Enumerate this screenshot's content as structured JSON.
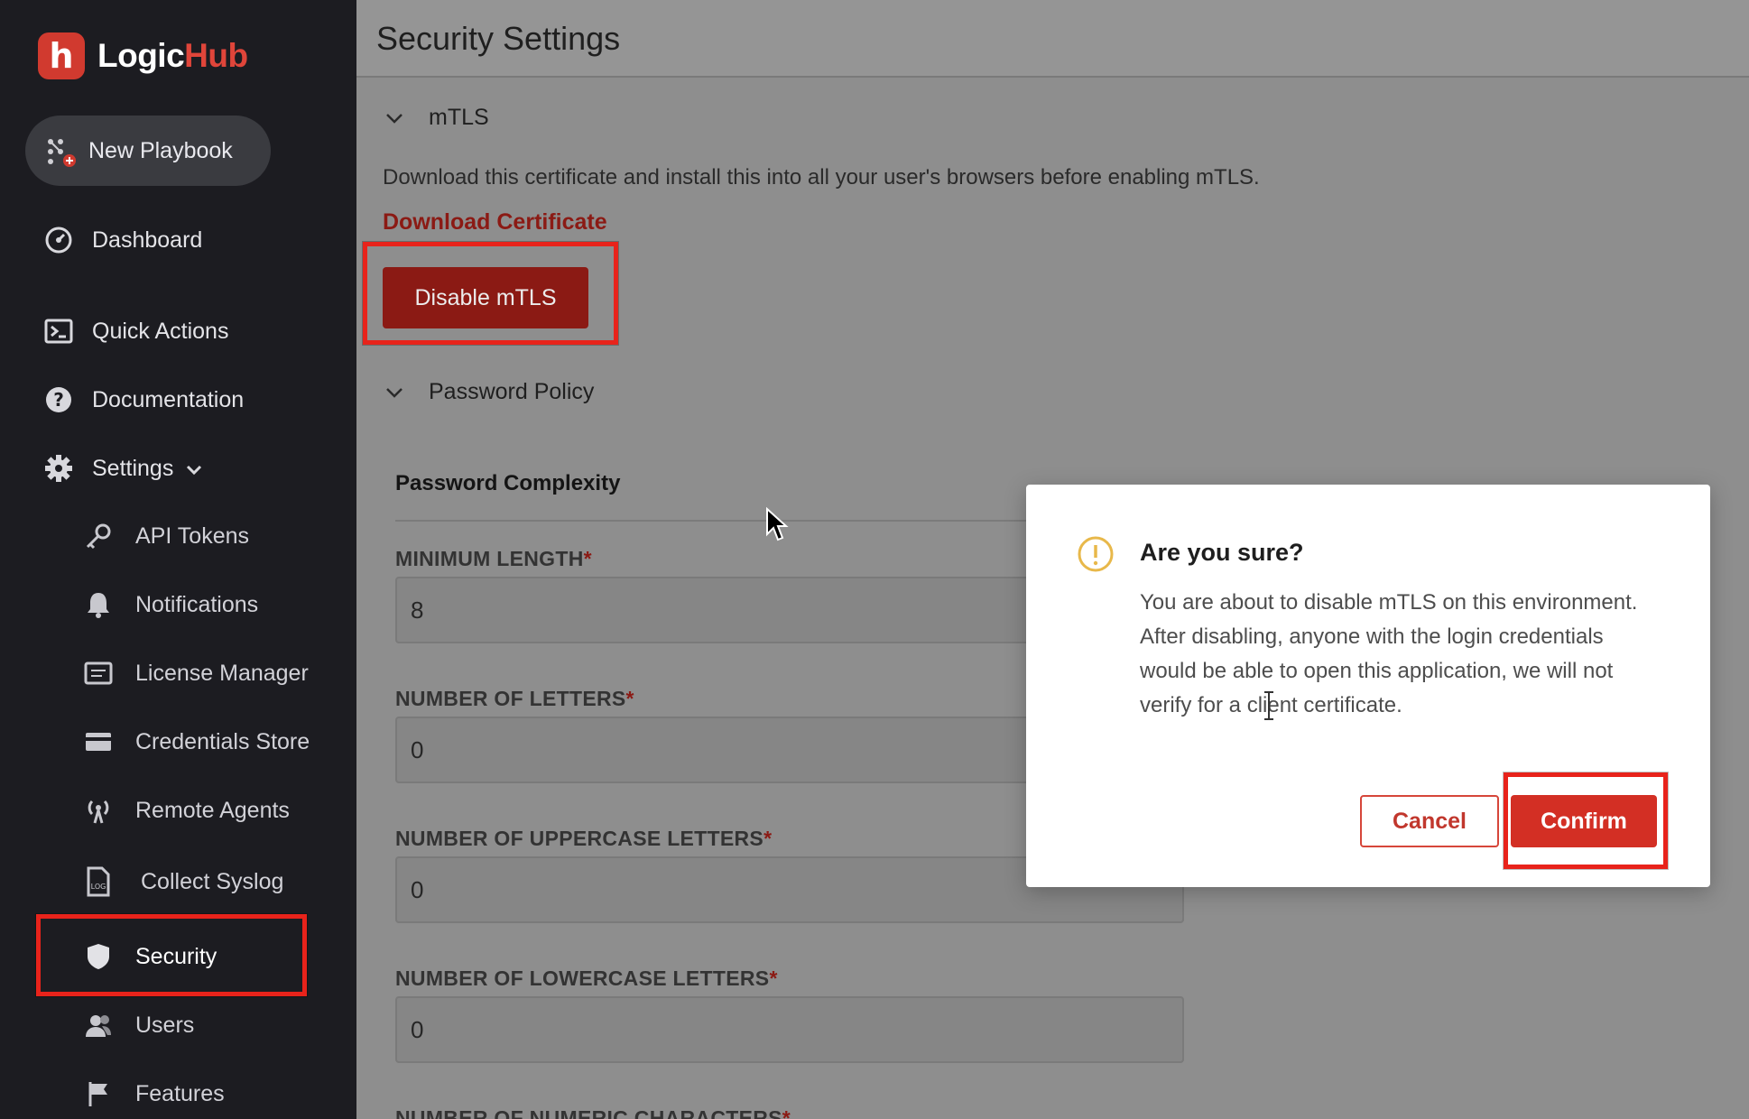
{
  "app": {
    "brand_a": "Logic",
    "brand_b": "Hub",
    "brand_initial": "h"
  },
  "sidebar": {
    "new_playbook": "New Playbook",
    "items": [
      {
        "label": "Dashboard",
        "icon": "dashboard-icon"
      },
      {
        "label": "Quick Actions",
        "icon": "terminal-icon"
      },
      {
        "label": "Documentation",
        "icon": "help-icon"
      },
      {
        "label": "Settings",
        "icon": "gear-icon"
      }
    ],
    "settings_items": [
      {
        "label": "API Tokens",
        "icon": "key-icon"
      },
      {
        "label": "Notifications",
        "icon": "bell-icon"
      },
      {
        "label": "License Manager",
        "icon": "license-icon"
      },
      {
        "label": "Credentials Store",
        "icon": "card-icon"
      },
      {
        "label": "Remote Agents",
        "icon": "broadcast-icon"
      },
      {
        "label": "Collect Syslog",
        "icon": "log-file-icon"
      },
      {
        "label": "Security",
        "icon": "shield-icon",
        "selected": true
      },
      {
        "label": "Users",
        "icon": "users-icon"
      },
      {
        "label": "Features",
        "icon": "flag-icon"
      }
    ]
  },
  "page": {
    "title": "Security Settings",
    "mtls": {
      "heading": "mTLS",
      "description": "Download this certificate and install this into all your user's browsers before enabling mTLS.",
      "download_link": "Download Certificate",
      "disable_button": "Disable mTLS"
    },
    "password_policy": {
      "heading": "Password Policy",
      "subheading": "Password Complexity",
      "fields": [
        {
          "label": "MINIMUM LENGTH",
          "value": "8"
        },
        {
          "label": "NUMBER OF LETTERS",
          "value": "0"
        },
        {
          "label": "NUMBER OF UPPERCASE LETTERS",
          "value": "0"
        },
        {
          "label": "NUMBER OF LOWERCASE LETTERS",
          "value": "0"
        },
        {
          "label": "NUMBER OF NUMERIC CHARACTERS",
          "value": ""
        }
      ],
      "required_mark": "*"
    }
  },
  "modal": {
    "title": "Are you sure?",
    "message": "You are about to disable mTLS on this environment. After disabling, anyone with the login credentials would be able to open this application, we will not verify for a client certificate.",
    "cancel": "Cancel",
    "confirm": "Confirm"
  },
  "colors": {
    "sidebar_bg": "#1c1c21",
    "brand_red": "#d13a2f",
    "overlay_bg": "#8e8e8e",
    "dim_red": "#8b1a14",
    "confirm_red": "#d32f24",
    "highlight": "#e8231b",
    "warning": "#e8b84a"
  }
}
